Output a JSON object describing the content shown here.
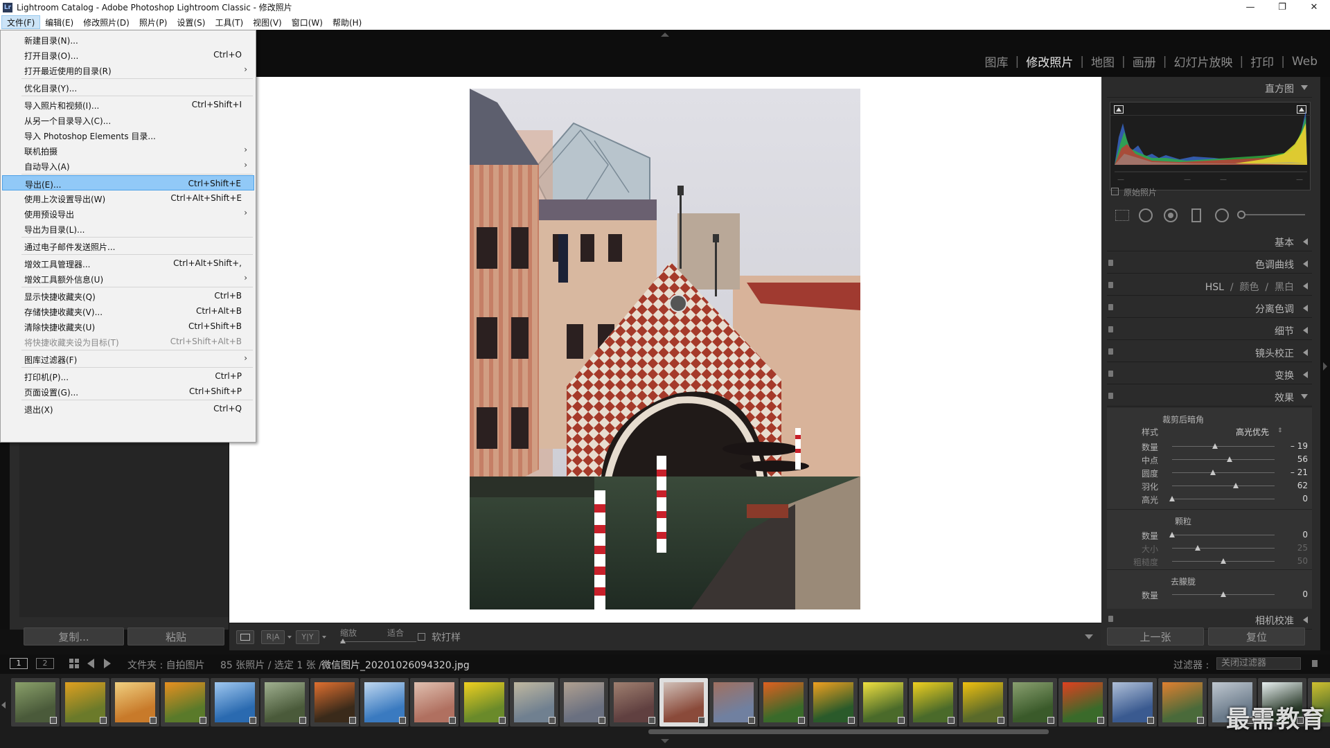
{
  "window": {
    "title": "Lightroom Catalog - Adobe Photoshop Lightroom Classic - 修改照片",
    "minimize": "—",
    "maximize": "❐",
    "close": "✕",
    "logo": "Lr"
  },
  "menubar": [
    "文件(F)",
    "编辑(E)",
    "修改照片(D)",
    "照片(P)",
    "设置(S)",
    "工具(T)",
    "视图(V)",
    "窗口(W)",
    "帮助(H)"
  ],
  "modules": [
    "图库",
    "修改照片",
    "地图",
    "画册",
    "幻灯片放映",
    "打印",
    "Web"
  ],
  "module_active": "修改照片",
  "file_menu": [
    {
      "label": "新建目录(N)...",
      "shortcut": ""
    },
    {
      "label": "打开目录(O)...",
      "shortcut": "Ctrl+O"
    },
    {
      "label": "打开最近使用的目录(R)",
      "shortcut": "",
      "submenu": true
    },
    {
      "label": "优化目录(Y)...",
      "shortcut": ""
    },
    {
      "label": "导入照片和视频(I)...",
      "shortcut": "Ctrl+Shift+I"
    },
    {
      "label": "从另一个目录导入(C)...",
      "shortcut": ""
    },
    {
      "label": "导入 Photoshop Elements 目录...",
      "shortcut": ""
    },
    {
      "label": "联机拍摄",
      "shortcut": "",
      "submenu": true
    },
    {
      "label": "自动导入(A)",
      "shortcut": "",
      "submenu": true
    },
    {
      "label": "导出(E)...",
      "shortcut": "Ctrl+Shift+E",
      "highlight": true
    },
    {
      "label": "使用上次设置导出(W)",
      "shortcut": "Ctrl+Alt+Shift+E"
    },
    {
      "label": "使用预设导出",
      "shortcut": "",
      "submenu": true
    },
    {
      "label": "导出为目录(L)...",
      "shortcut": ""
    },
    {
      "label": "通过电子邮件发送照片...",
      "shortcut": ""
    },
    {
      "label": "增效工具管理器...",
      "shortcut": "Ctrl+Alt+Shift+,"
    },
    {
      "label": "增效工具额外信息(U)",
      "shortcut": "",
      "submenu": true
    },
    {
      "label": "显示快捷收藏夹(Q)",
      "shortcut": "Ctrl+B"
    },
    {
      "label": "存储快捷收藏夹(V)...",
      "shortcut": "Ctrl+Alt+B"
    },
    {
      "label": "清除快捷收藏夹(U)",
      "shortcut": "Ctrl+Shift+B"
    },
    {
      "label": "将快捷收藏夹设为目标(T)",
      "shortcut": "Ctrl+Shift+Alt+B",
      "disabled": true
    },
    {
      "label": "图库过滤器(F)",
      "shortcut": "",
      "submenu": true
    },
    {
      "label": "打印机(P)...",
      "shortcut": "Ctrl+P"
    },
    {
      "label": "页面设置(G)...",
      "shortcut": "Ctrl+Shift+P"
    },
    {
      "label": "退出(X)",
      "shortcut": "Ctrl+Q"
    }
  ],
  "left_buttons": {
    "copy": "复制...",
    "paste": "粘贴"
  },
  "toolbar": {
    "zoom_label": "缩放",
    "fit_label": "适合",
    "softproof_label": "软打样",
    "ra": "R|A",
    "yy": "Y|Y"
  },
  "right_panel": {
    "histogram_title": "直方图",
    "original_photo": "原始照片",
    "sections": [
      "基本",
      "色调曲线",
      "分离色调",
      "细节",
      "镜头校正",
      "变换",
      "效果",
      "相机校准"
    ],
    "hsl": {
      "a": "HSL",
      "b": "颜色",
      "c": "黑白"
    },
    "vignette": {
      "title": "裁剪后暗角",
      "style_label": "样式",
      "style_value": "高光优先",
      "rows": [
        {
          "label": "数量",
          "value": "– 19",
          "pos": 0.42
        },
        {
          "label": "中点",
          "value": "56",
          "pos": 0.56
        },
        {
          "label": "圆度",
          "value": "– 21",
          "pos": 0.4
        },
        {
          "label": "羽化",
          "value": "62",
          "pos": 0.62
        },
        {
          "label": "高光",
          "value": "0",
          "pos": 0.0
        }
      ]
    },
    "grain": {
      "title": "颗粒",
      "rows": [
        {
          "label": "数量",
          "value": "0",
          "pos": 0.0,
          "dim": false
        },
        {
          "label": "大小",
          "value": "25",
          "pos": 0.25,
          "dim": true
        },
        {
          "label": "粗糙度",
          "value": "50",
          "pos": 0.5,
          "dim": true
        }
      ]
    },
    "dehaze": {
      "title": "去朦胧",
      "rows": [
        {
          "label": "数量",
          "value": "0",
          "pos": 0.5,
          "dim": false
        }
      ]
    },
    "prev_button": "上一张",
    "reset_button": "复位"
  },
  "filmbar": {
    "view1": "1",
    "view2": "2",
    "folder": "文件夹 : 自拍图片",
    "count": "85 张照片 / 选定 1 张 /",
    "filename": "微信图片_20201026094320.jpg",
    "filter_label": "过滤器 :",
    "filter_value": "关闭过滤器"
  },
  "thumbnails": [
    {
      "c1": "#4a5a3a",
      "c2": "#8aa06a"
    },
    {
      "c1": "#6b7a2a",
      "c2": "#e0a020"
    },
    {
      "c1": "#c87a2a",
      "c2": "#f0d080"
    },
    {
      "c1": "#5a7a2a",
      "c2": "#e89020"
    },
    {
      "c1": "#2a6ab0",
      "c2": "#a0c8f0"
    },
    {
      "c1": "#4a5a3a",
      "c2": "#a0b090"
    },
    {
      "c1": "#3a2a1a",
      "c2": "#e07030"
    },
    {
      "c1": "#3a7ac0",
      "c2": "#c0d8f0"
    },
    {
      "c1": "#b07060",
      "c2": "#e0c0b0"
    },
    {
      "c1": "#6a8a2a",
      "c2": "#f0d020"
    },
    {
      "c1": "#708090",
      "c2": "#c0b8a0"
    },
    {
      "c1": "#6a7080",
      "c2": "#b0a090"
    },
    {
      "c1": "#604040",
      "c2": "#a08070"
    },
    {
      "c1": "#8a4a3a",
      "c2": "#d0c0b8"
    },
    {
      "c1": "#7080a0",
      "c2": "#a07060"
    },
    {
      "c1": "#3a6a2a",
      "c2": "#e06020"
    },
    {
      "c1": "#2a5a2a",
      "c2": "#f0a020"
    },
    {
      "c1": "#4a6a2a",
      "c2": "#f0e040"
    },
    {
      "c1": "#4a6a2a",
      "c2": "#f0d020"
    },
    {
      "c1": "#5a6a2a",
      "c2": "#f0c010"
    },
    {
      "c1": "#3a5a2a",
      "c2": "#8aa070"
    },
    {
      "c1": "#3a6a2a",
      "c2": "#e04020"
    },
    {
      "c1": "#3a5a90",
      "c2": "#b0c0d8"
    },
    {
      "c1": "#4a6a3a",
      "c2": "#e08030"
    },
    {
      "c1": "#6a7a8a",
      "c2": "#c0c8d0"
    },
    {
      "c1": "#2a3a2a",
      "c2": "#e8f0f0"
    },
    {
      "c1": "#4a6a2a",
      "c2": "#d0c030"
    }
  ],
  "selected_thumb": 13,
  "watermark": "最需教育"
}
